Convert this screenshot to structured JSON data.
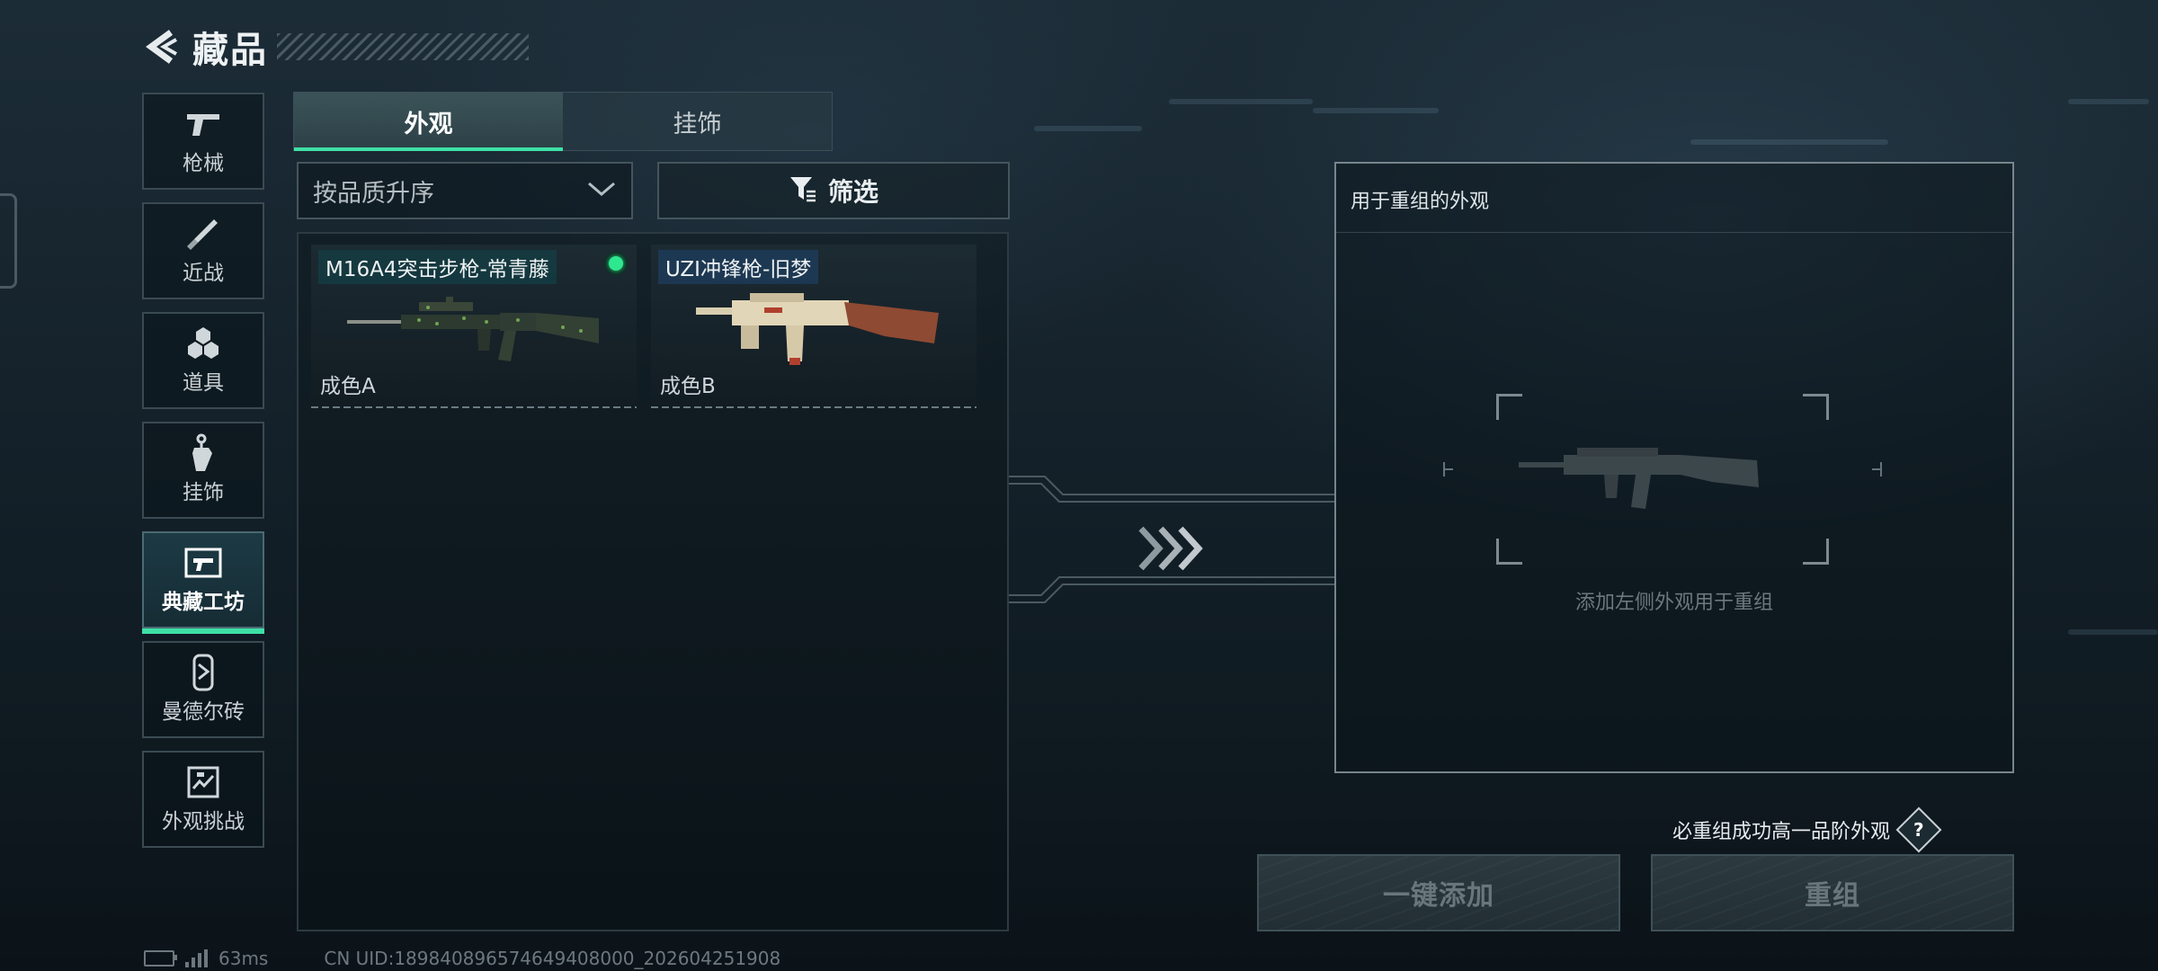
{
  "header": {
    "back_icon": "back-chevron-icon",
    "title": "藏品"
  },
  "sidebar": {
    "items": [
      {
        "label": "枪械",
        "icon": "gun-icon"
      },
      {
        "label": "近战",
        "icon": "knife-icon"
      },
      {
        "label": "道具",
        "icon": "gear-items-icon"
      },
      {
        "label": "挂饰",
        "icon": "charm-icon"
      },
      {
        "label": "典藏工坊",
        "icon": "workshop-icon",
        "active": true
      },
      {
        "label": "曼德尔砖",
        "icon": "brick-icon"
      },
      {
        "label": "外观挑战",
        "icon": "challenge-icon"
      }
    ]
  },
  "tabs": [
    {
      "label": "外观",
      "active": true
    },
    {
      "label": "挂饰",
      "active": false
    }
  ],
  "sort": {
    "label": "按品质升序"
  },
  "filter": {
    "label": "筛选",
    "icon": "filter-icon"
  },
  "items": [
    {
      "name": "M16A4突击步枪-常青藤",
      "grade": "成色A",
      "equipped": true,
      "weapon_icon": "rifle-icon"
    },
    {
      "name": "UZI冲锋枪-旧梦",
      "grade": "成色B",
      "equipped": false,
      "weapon_icon": "smg-icon"
    }
  ],
  "recombine": {
    "title": "用于重组的外观",
    "hint": "添加左侧外观用于重组",
    "upgrade_note": "必重组成功高一品阶外观",
    "help_label": "?"
  },
  "buttons": {
    "add_all": "一键添加",
    "recombine": "重组"
  },
  "status": {
    "ping": "63ms",
    "uid": "CN UID:18984089657464940800​0_202604251908"
  },
  "colors": {
    "accent": "#3ee0a6",
    "equipped": "#2ee88f"
  }
}
